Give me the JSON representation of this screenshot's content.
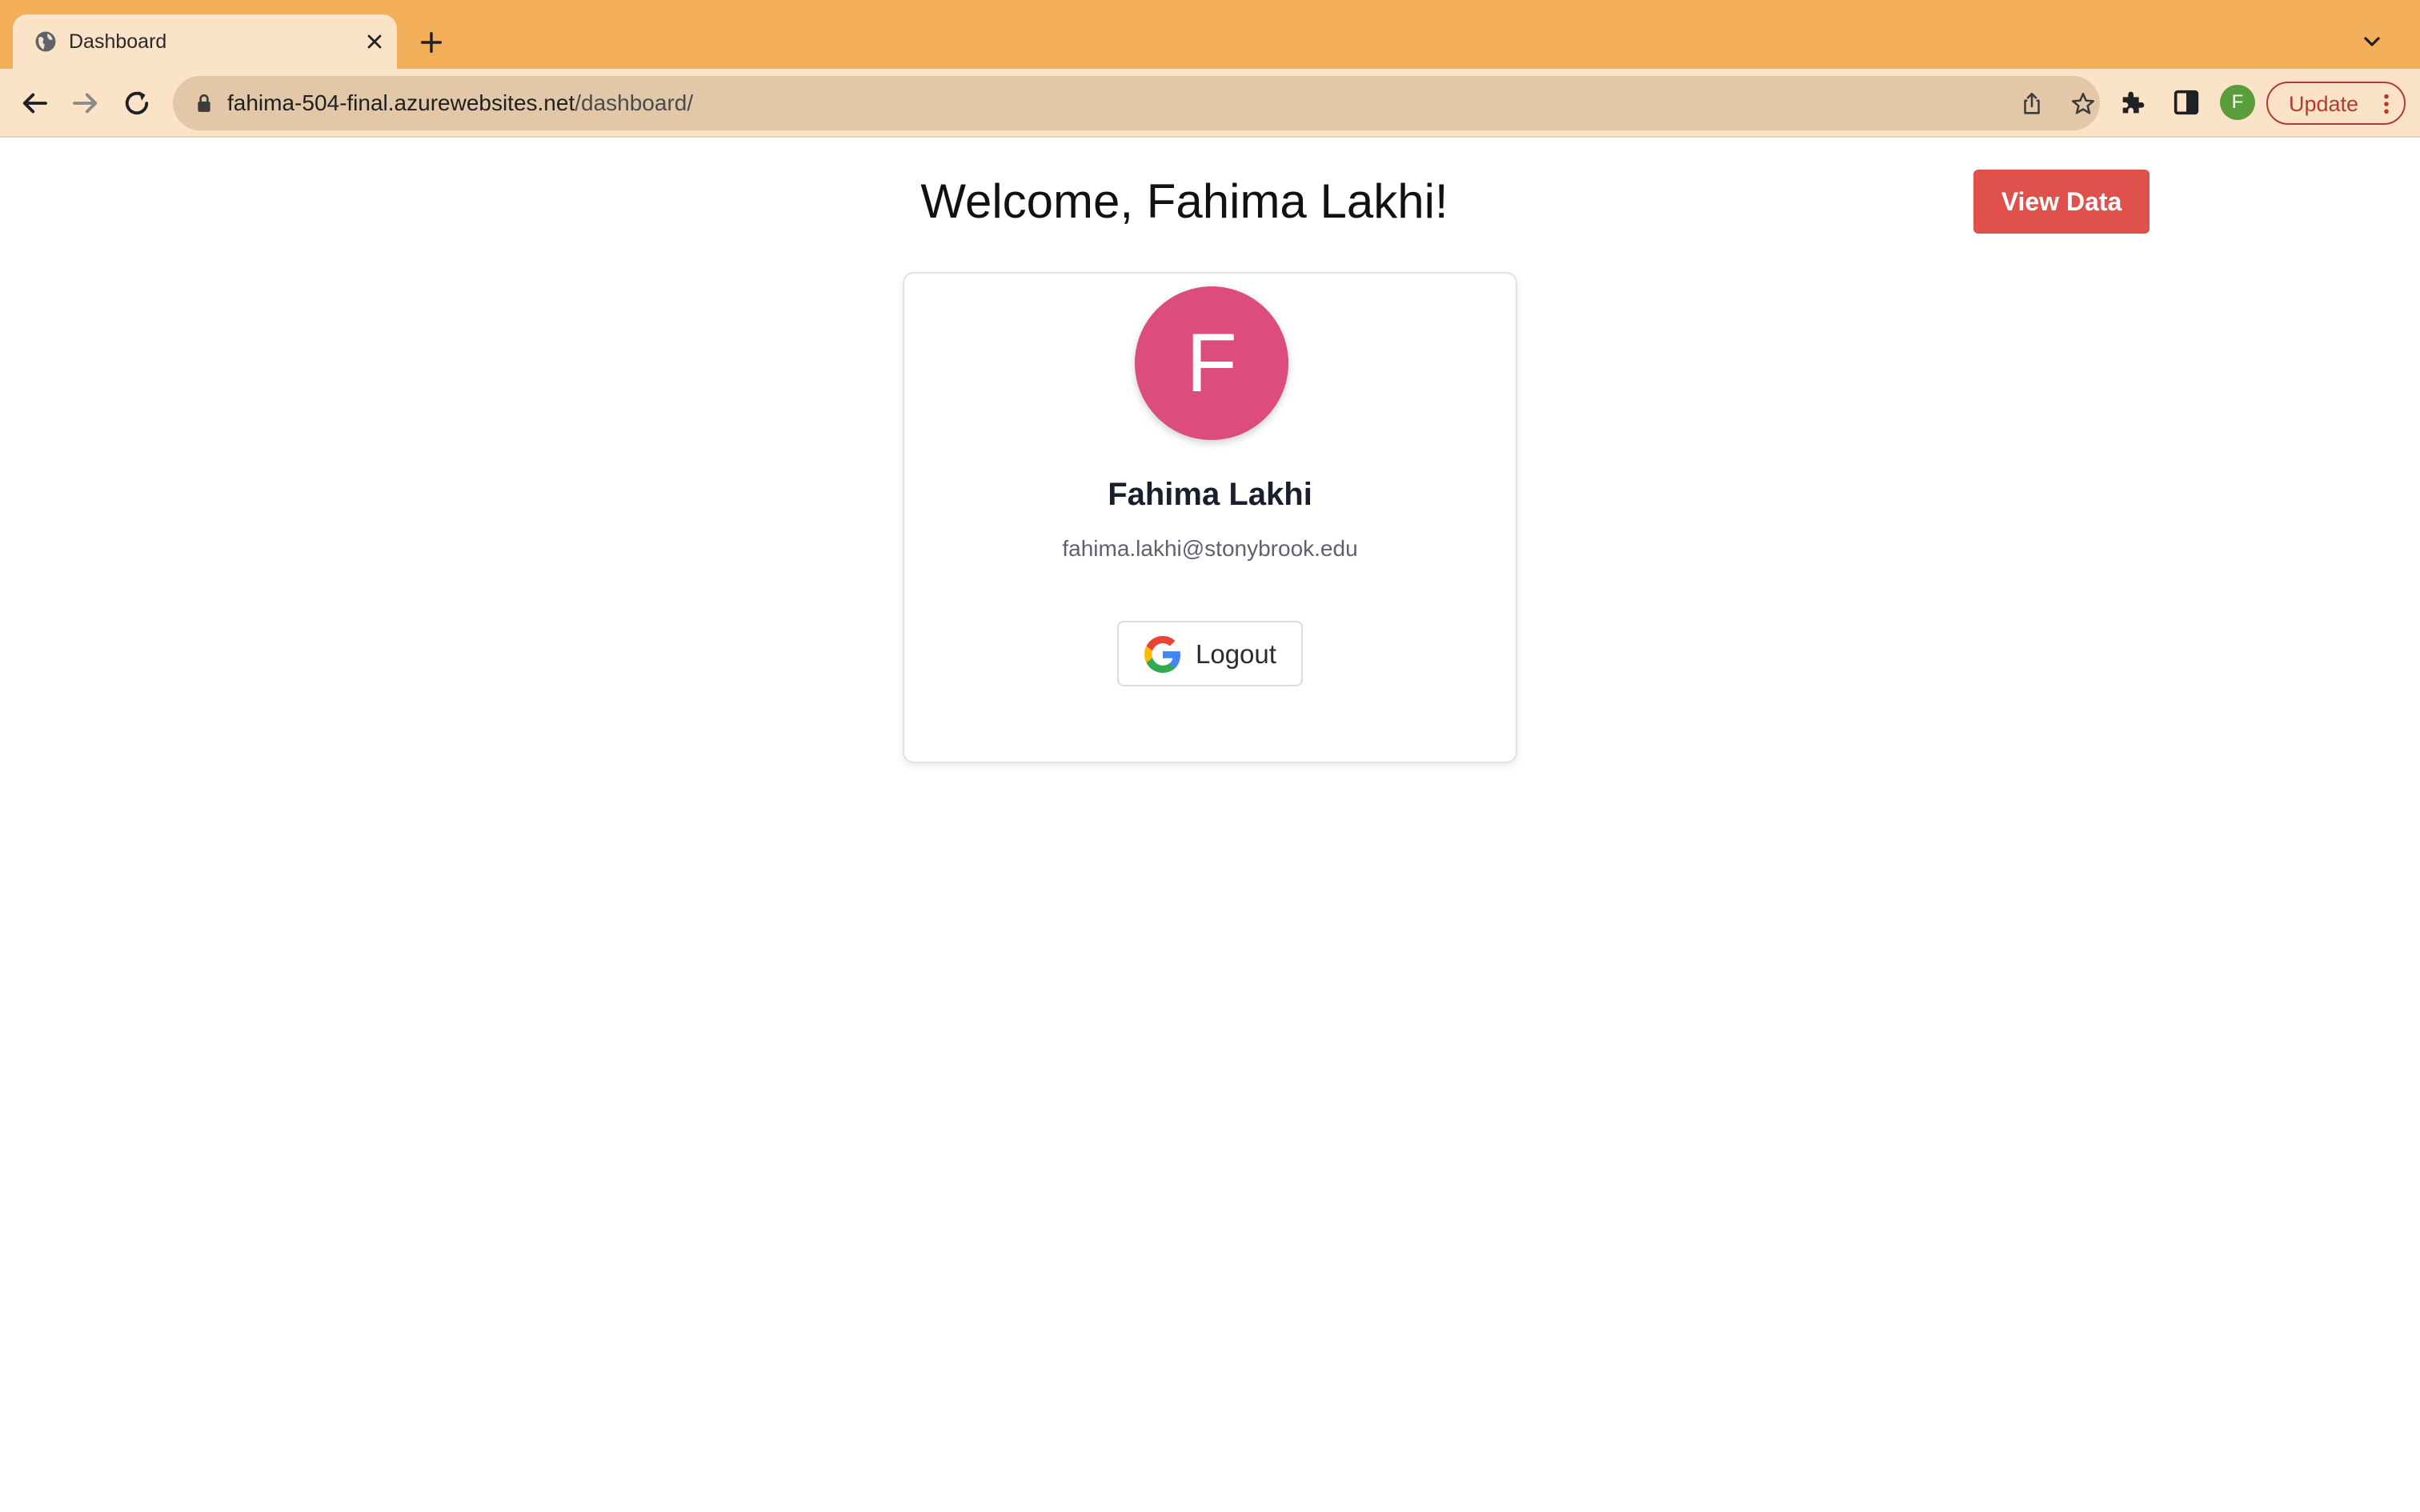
{
  "browser": {
    "tab_title": "Dashboard",
    "url_host": "fahima-504-final.azurewebsites.net",
    "url_path": "/dashboard/",
    "profile_initial": "F",
    "update_label": "Update",
    "colors": {
      "tabstrip": "#f4af5a",
      "toolbar": "#fae3c7",
      "update_accent": "#b53b2a"
    }
  },
  "page": {
    "welcome_text": "Welcome, Fahima Lakhi!",
    "view_data_label": "View Data",
    "profile": {
      "avatar_initial": "F",
      "name": "Fahima Lakhi",
      "email": "fahima.lakhi@stonybrook.edu"
    },
    "logout_label": "Logout",
    "colors": {
      "view_data_bg": "#e0514c",
      "avatar_bg": "#dc4d7b"
    }
  }
}
